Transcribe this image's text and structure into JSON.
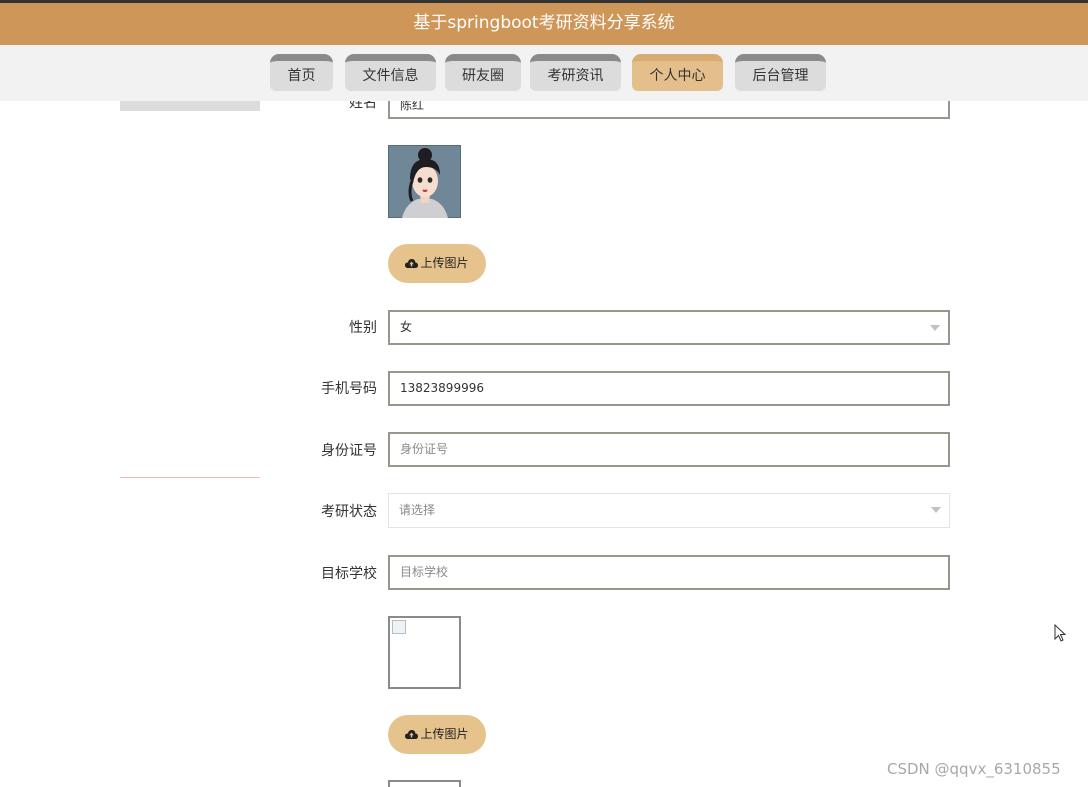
{
  "app": {
    "title": "基于springboot考研资料分享系统"
  },
  "nav": {
    "items": [
      {
        "label": "首页"
      },
      {
        "label": "文件信息"
      },
      {
        "label": "研友圈"
      },
      {
        "label": "考研资讯"
      },
      {
        "label": "个人中心",
        "active": true
      },
      {
        "label": "后台管理"
      }
    ]
  },
  "form": {
    "name": {
      "label": "姓名",
      "value": "陈红"
    },
    "avatar_upload_label": "上传图片",
    "gender": {
      "label": "性别",
      "value": "女"
    },
    "phone": {
      "label": "手机号码",
      "value": "13823899996"
    },
    "id_card": {
      "label": "身份证号",
      "placeholder": "身份证号"
    },
    "exam_status": {
      "label": "考研状态",
      "placeholder": "请选择"
    },
    "target_school": {
      "label": "目标学校",
      "placeholder": "目标学校"
    },
    "school_image_upload_label": "上传图片"
  },
  "watermark": "CSDN @qqvx_6310855",
  "colors": {
    "header": "#cf9659",
    "active_tab": "#e4bf8b",
    "upload_button": "#e6c38d"
  },
  "icons": {
    "upload": "cloud-upload-icon",
    "dropdown": "chevron-down-icon",
    "cursor": "mouse-cursor-icon"
  }
}
